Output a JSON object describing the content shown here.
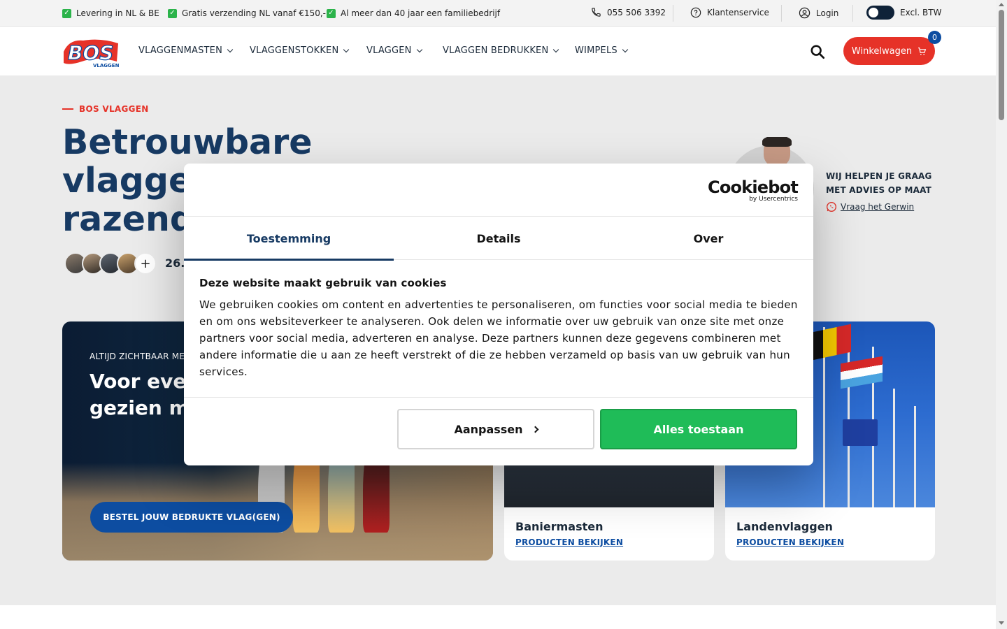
{
  "topbar": {
    "usps": [
      "Levering in NL & BE",
      "Gratis verzending NL vanaf €150,-",
      "Al meer dan 40 jaar een familiebedrijf"
    ],
    "phone": "055 506 3392",
    "service": "Klantenservice",
    "login": "Login",
    "vat_toggle_label": "Excl. BTW"
  },
  "nav": {
    "logo_text": "BOS",
    "logo_sub": "VLAGGEN",
    "menu": [
      "VLAGGENMASTEN",
      "VLAGGENSTOKKEN",
      "VLAGGEN",
      "VLAGGEN BEDRUKKEN",
      "WIMPELS"
    ],
    "cart_label": "Winkelwagen",
    "cart_count": "0"
  },
  "hero": {
    "eyebrow": "BOS VLAGGEN",
    "title_line1": "Betrouwbare",
    "title_line2": "vlaggen",
    "title_line3": "razend s",
    "review_count": "26.",
    "advisor_title": "WIJ HELPEN JE GRAAG MET ADVIES OP MAAT",
    "advisor_link": "Vraag het Gerwin"
  },
  "cards": {
    "big": {
      "eyebrow": "ALTIJD ZICHTBAAR ME",
      "title": "Voor evenemen gezien mo worden",
      "cta": "BESTEL JOUW BEDRUKTE VLAG(GEN)"
    },
    "small": [
      {
        "name": "Baniermasten",
        "link": "PRODUCTEN BEKIJKEN"
      },
      {
        "name": "Landenvlaggen",
        "link": "PRODUCTEN BEKIJKEN"
      }
    ]
  },
  "cookie_dialog": {
    "brand": "Cookiebot",
    "brand_sub": "by Usercentrics",
    "tabs": [
      "Toestemming",
      "Details",
      "Over"
    ],
    "active_tab": "Toestemming",
    "heading": "Deze website maakt gebruik van cookies",
    "body": "We gebruiken cookies om content en advertenties te personaliseren, om functies voor social media te bieden en om ons websiteverkeer te analyseren. Ook delen we informatie over uw gebruik van onze site met onze partners voor social media, adverteren en analyse. Deze partners kunnen deze gegevens combineren met andere informatie die u aan ze heeft verstrekt of die ze hebben verzameld op basis van uw gebruik van hun services.",
    "customize_label": "Aanpassen",
    "allow_all_label": "Alles toestaan"
  },
  "colors": {
    "brand_red": "#e63228",
    "brand_blue": "#0d4da1",
    "navy": "#173a63",
    "allow_green": "#1fbc58"
  }
}
